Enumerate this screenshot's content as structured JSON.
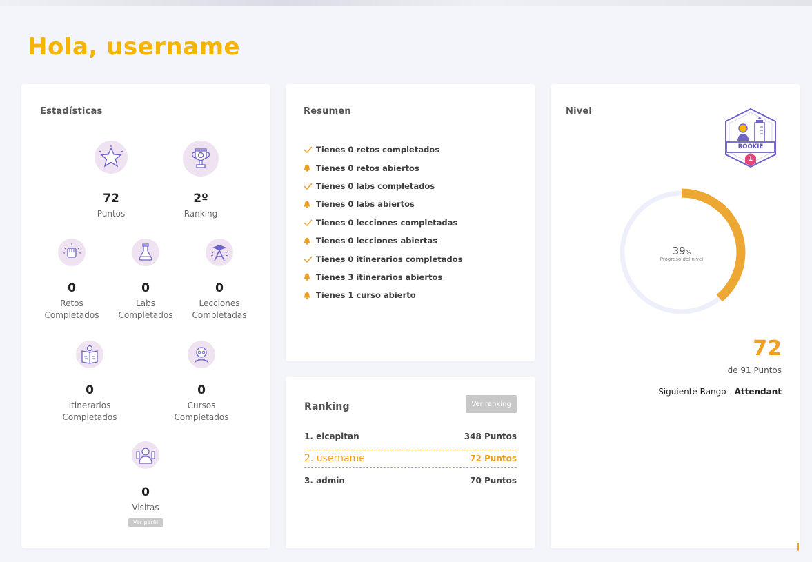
{
  "greeting": "Hola, username",
  "stats": {
    "title": "Estadísticas",
    "puntos": {
      "value": "72",
      "label": "Puntos",
      "icon": "star-icon"
    },
    "ranking": {
      "value": "2º",
      "label": "Ranking",
      "icon": "trophy-icon"
    },
    "retos": {
      "value": "0",
      "label1": "Retos",
      "label2": "Completados",
      "icon": "fist-icon"
    },
    "labs": {
      "value": "0",
      "label1": "Labs",
      "label2": "Completados",
      "icon": "flask-icon"
    },
    "lecciones": {
      "value": "0",
      "label1": "Lecciones",
      "label2": "Completadas",
      "icon": "graduate-icon"
    },
    "itinerarios": {
      "value": "0",
      "label1": "Itinerarios",
      "label2": "Completados",
      "icon": "map-book-icon"
    },
    "cursos": {
      "value": "0",
      "label1": "Cursos",
      "label2": "Completados",
      "icon": "student-icon"
    },
    "visitas": {
      "value": "0",
      "label": "Visitas",
      "button": "Ver perfil",
      "icon": "visitor-icon"
    }
  },
  "resumen": {
    "title": "Resumen",
    "items": [
      {
        "type": "check",
        "text": "Tienes 0 retos completados"
      },
      {
        "type": "bell",
        "text": "Tienes 0 retos abiertos"
      },
      {
        "type": "check",
        "text": "Tienes 0 labs completados"
      },
      {
        "type": "bell",
        "text": "Tienes 0 labs abiertos"
      },
      {
        "type": "check",
        "text": "Tienes 0 lecciones completadas"
      },
      {
        "type": "bell",
        "text": "Tienes 0 lecciones abiertas"
      },
      {
        "type": "check",
        "text": "Tienes 0 itinerarios completados"
      },
      {
        "type": "bell",
        "text": "Tienes 3 itinerarios abiertos"
      },
      {
        "type": "bell",
        "text": "Tienes 1 curso abierto"
      }
    ]
  },
  "ranking": {
    "title": "Ranking",
    "button": "Ver ranking",
    "rows": [
      {
        "name": "1. elcapitan",
        "points": "348 Puntos"
      },
      {
        "name": "2. username",
        "points": "72 Puntos"
      },
      {
        "name": "3. admin",
        "points": "70 Puntos"
      }
    ]
  },
  "nivel": {
    "title": "Nivel",
    "badge": "ROOKIE",
    "badge_level": "1",
    "progress_value": "39",
    "progress_unit": "%",
    "progress_fraction": 0.39,
    "progress_label": "Progreso del nivel",
    "points": "72",
    "points_total": "de 91 Puntos",
    "next_prefix": "Siguiente Rango - ",
    "next_rank": "Attendant"
  },
  "colors": {
    "accent": "#f4b400",
    "orange": "#f0a021",
    "icon_bg": "#efe2f1",
    "icon_line": "#6d63c9"
  }
}
